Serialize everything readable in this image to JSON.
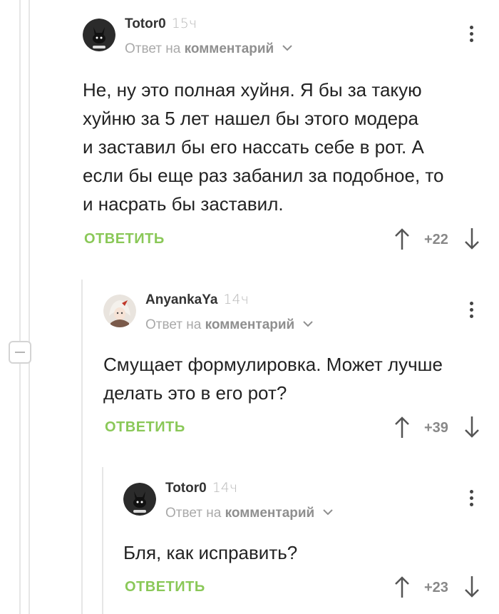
{
  "comments": [
    {
      "author": "Totor0",
      "time": "15ч",
      "reply_prefix": "Ответ на",
      "reply_target": "комментарий",
      "lines": [
        "Не, ну это полная хуйня. Я бы за такую",
        "хуйню за 5 лет нашел бы этого модера",
        "и заставил бы его нассать себе в рот. А",
        "если бы еще раз забанил за подобное, то",
        "и насрать бы заставил."
      ],
      "reply_label": "ОТВЕТИТЬ",
      "score": "+22"
    },
    {
      "author": "AnyankaYa",
      "time": "14ч",
      "reply_prefix": "Ответ на",
      "reply_target": "комментарий",
      "lines": [
        "Смущает формулировка. Может лучше",
        "делать это в его рот?"
      ],
      "reply_label": "ОТВЕТИТЬ",
      "score": "+39"
    },
    {
      "author": "Totor0",
      "time": "14ч",
      "reply_prefix": "Ответ на",
      "reply_target": "комментарий",
      "lines": [
        "Бля, как исправить?"
      ],
      "reply_label": "ОТВЕТИТЬ",
      "score": "+23"
    }
  ],
  "colors": {
    "accent": "#8ac858",
    "thread_line": "#e6e6e6"
  },
  "icons": [
    "bunny-avatar-icon",
    "anime-avatar-icon",
    "more-vertical-icon",
    "arrow-up-icon",
    "arrow-down-icon",
    "chevron-down-icon",
    "collapse-minus-icon"
  ]
}
